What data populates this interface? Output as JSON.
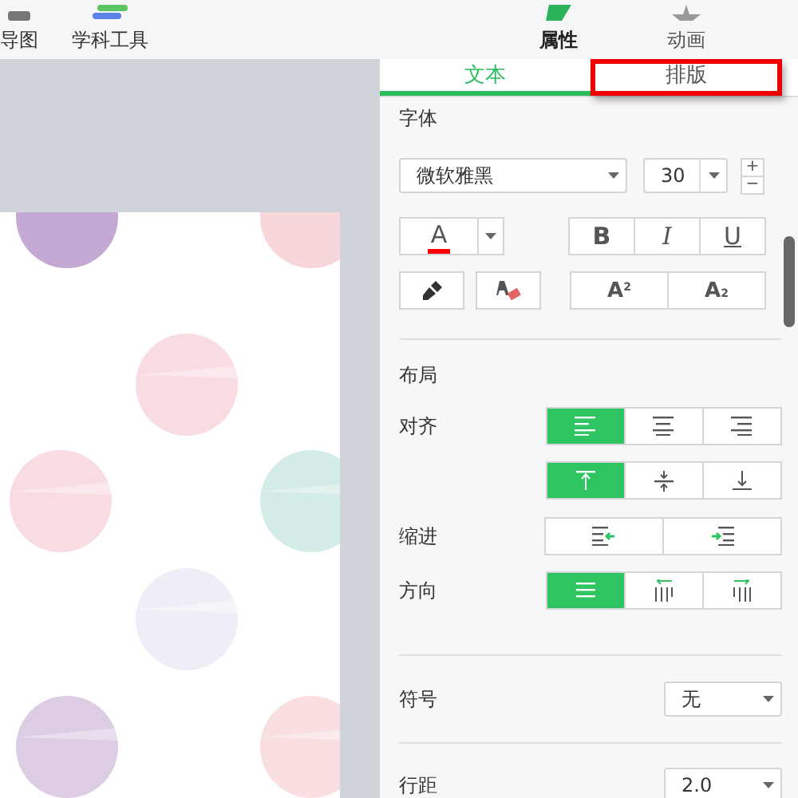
{
  "toolbar": {
    "items": [
      {
        "label": "导图",
        "kind": "bar"
      },
      {
        "label": "学科工具",
        "kind": "books"
      }
    ],
    "panel_tabs": [
      {
        "label": "属性",
        "kind": "tag",
        "selected": true
      },
      {
        "label": "动画",
        "kind": "star",
        "selected": false
      }
    ]
  },
  "panel": {
    "tabs": [
      {
        "label": "文本",
        "selected": true,
        "highlighted": false
      },
      {
        "label": "排版",
        "selected": false,
        "highlighted": true
      }
    ],
    "font_title": "字体",
    "font_family": "微软雅黑",
    "font_size": "30",
    "size_up": "+",
    "size_down": "−",
    "styles": [
      {
        "kind": "bold",
        "label": "B"
      },
      {
        "kind": "italic",
        "label": "I"
      },
      {
        "kind": "underline",
        "label": "U"
      }
    ],
    "scripts": [
      {
        "kind": "sup",
        "label": "A",
        "mark": "2"
      },
      {
        "kind": "sub",
        "label": "A",
        "mark": "2"
      }
    ],
    "color_letter": "A",
    "layout_title": "布局",
    "rows": [
      {
        "label": "对齐",
        "options": [
          {
            "kind": "align-left",
            "selected": true
          },
          {
            "kind": "align-center",
            "selected": false
          },
          {
            "kind": "align-right",
            "selected": false
          }
        ]
      },
      {
        "options": [
          {
            "kind": "valign-top",
            "selected": true
          },
          {
            "kind": "valign-middle",
            "selected": false
          },
          {
            "kind": "valign-bottom",
            "selected": false
          }
        ]
      },
      {
        "label": "缩进",
        "options": [
          {
            "kind": "indent-less",
            "selected": false
          },
          {
            "kind": "indent-more",
            "selected": false
          }
        ]
      },
      {
        "label": "方向",
        "options": [
          {
            "kind": "horizontal",
            "selected": true
          },
          {
            "kind": "vertical-rtl",
            "selected": false
          },
          {
            "kind": "vertical-ltr",
            "selected": false
          }
        ]
      }
    ],
    "bullet_label": "符号",
    "bullet_value": "无",
    "spacing_label": "行距",
    "spacing_value": "2.0"
  }
}
